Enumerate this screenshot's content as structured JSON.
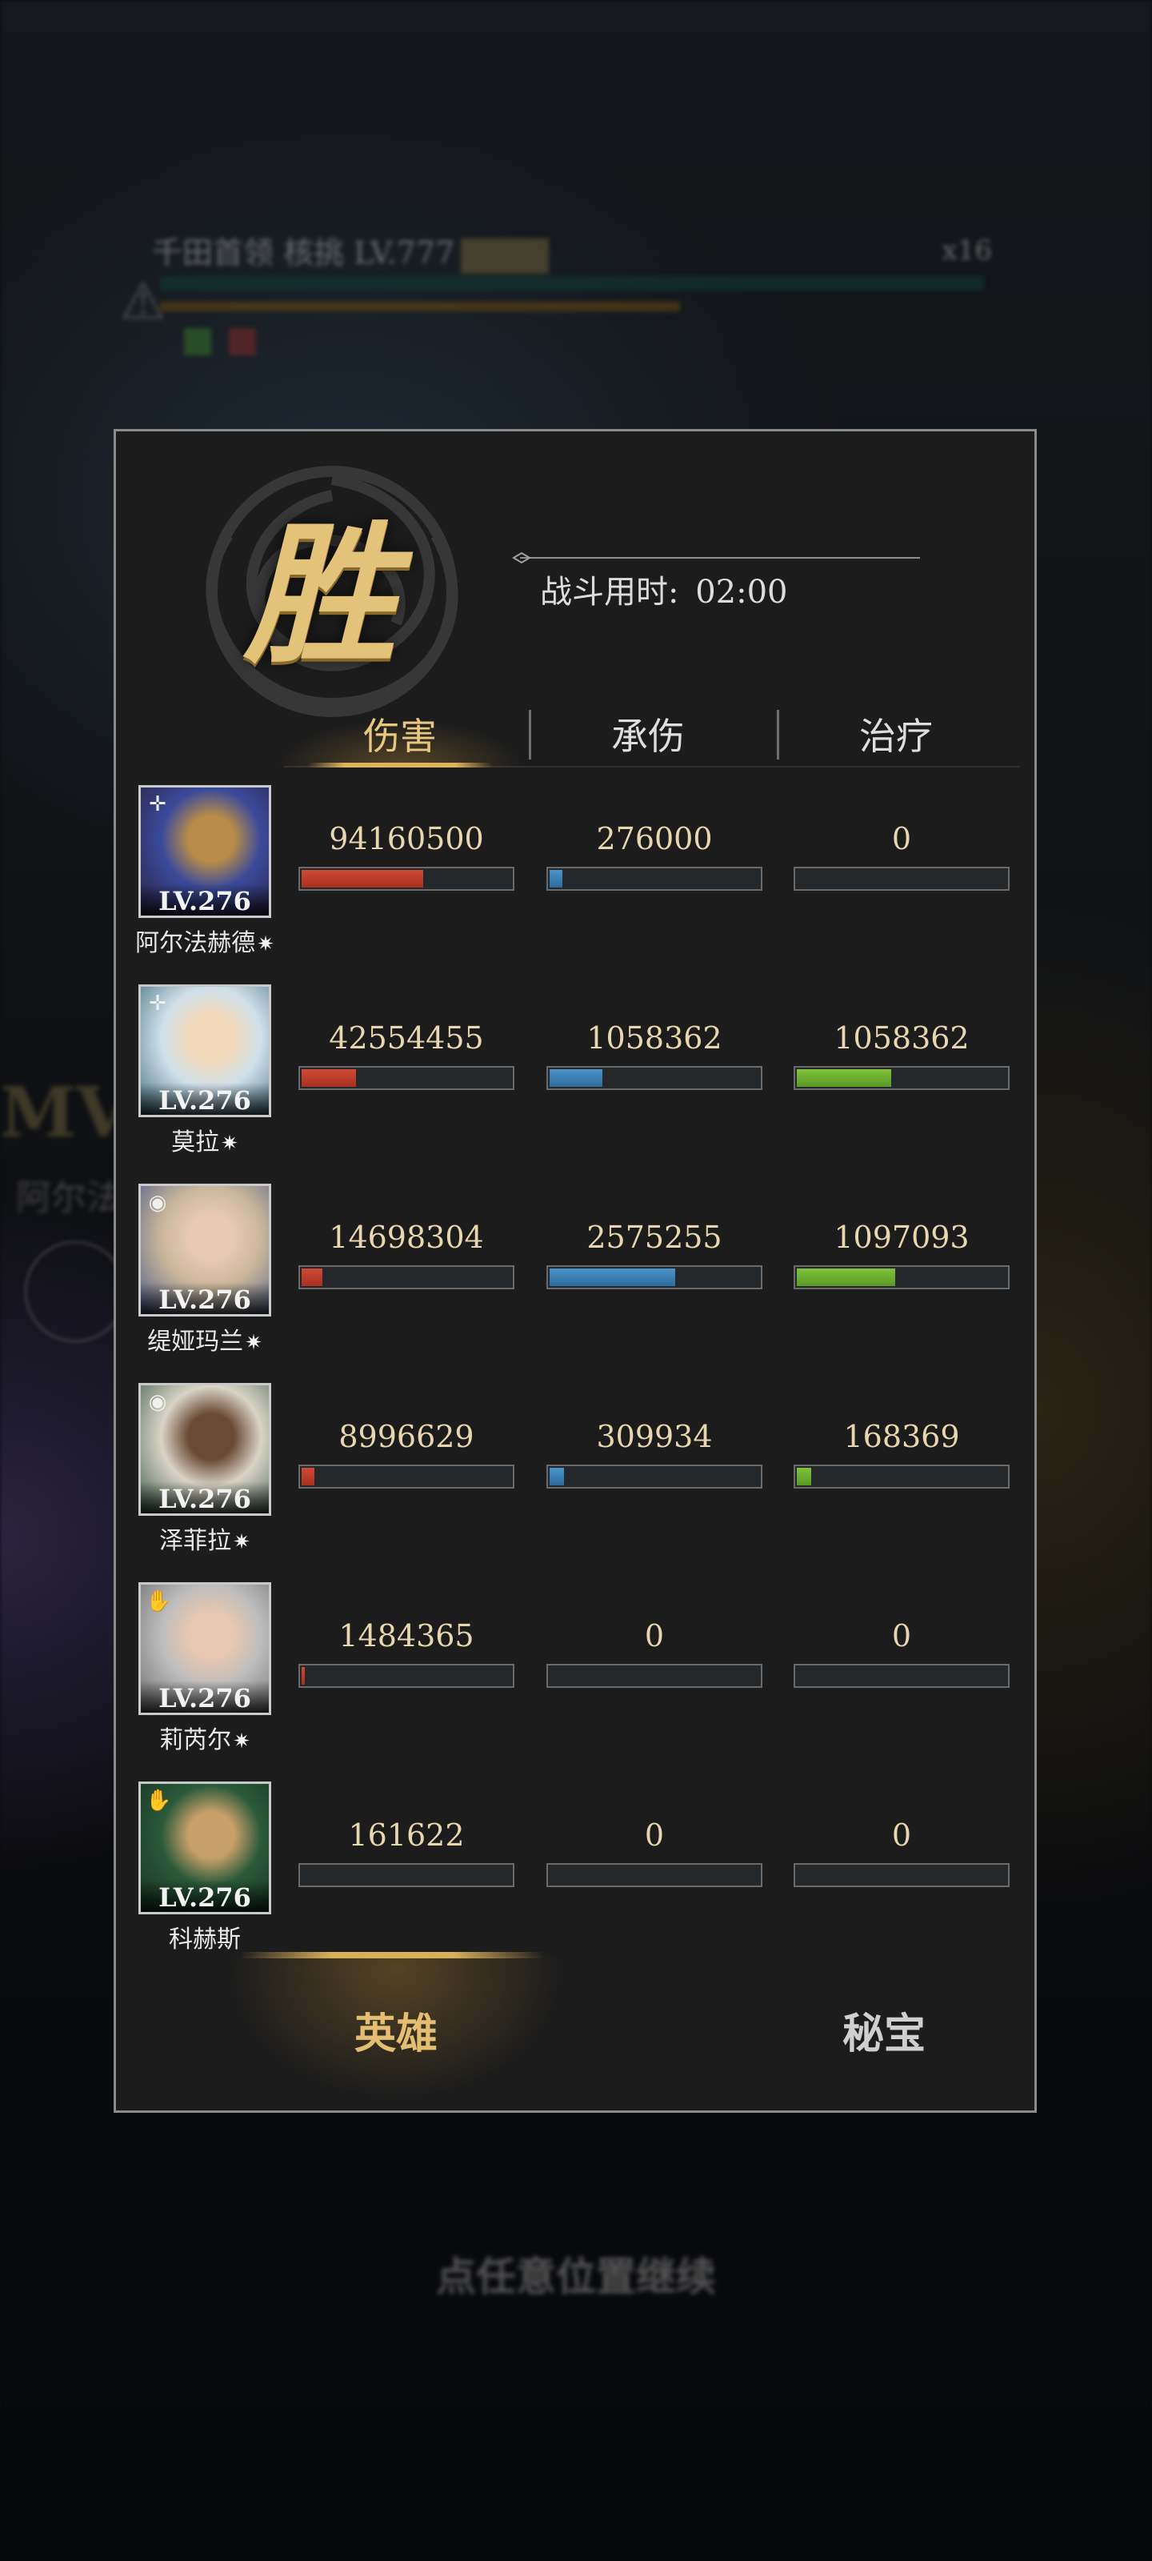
{
  "background": {
    "boss_name": "千田首领 核挑 LV.777",
    "boss_count": "x16",
    "side_mvp": "MV",
    "side_name": "阿尔法",
    "continue_hint": "点任意位置继续"
  },
  "panel": {
    "result_title": "胜",
    "battle_time_label": "战斗用时:",
    "battle_time_value": "02:00",
    "tabs": [
      {
        "label": "伤害",
        "active": true
      },
      {
        "label": "承伤",
        "active": false
      },
      {
        "label": "治疗",
        "active": false
      }
    ],
    "bottom_tabs": [
      {
        "label": "英雄",
        "active": true
      },
      {
        "label": "秘宝",
        "active": false
      }
    ]
  },
  "heroes": [
    {
      "name": "阿尔法赫德",
      "star": "✷",
      "level": "LV.276",
      "class_icon": "cross-icon",
      "class_glyph": "✛",
      "damage": "94160500",
      "damage_pct": 0.58,
      "taken": "276000",
      "taken_pct": 0.06,
      "heal": "0",
      "heal_pct": 0,
      "art": {
        "a": "#3a4a9a",
        "b": "#b98c4a",
        "c": "#2a2040"
      }
    },
    {
      "name": "莫拉",
      "star": "✷",
      "level": "LV.276",
      "class_icon": "cross-icon",
      "class_glyph": "✛",
      "damage": "42554455",
      "damage_pct": 0.26,
      "taken": "1058362",
      "taken_pct": 0.25,
      "heal": "1058362",
      "heal_pct": 0.45,
      "art": {
        "a": "#cfe0ea",
        "b": "#f0d7b8",
        "c": "#3d6a7a"
      }
    },
    {
      "name": "缇娅玛兰",
      "star": "✷",
      "level": "LV.276",
      "class_icon": "swirl-icon",
      "class_glyph": "◉",
      "damage": "14698304",
      "damage_pct": 0.1,
      "taken": "2575255",
      "taken_pct": 0.6,
      "heal": "1097093",
      "heal_pct": 0.47,
      "art": {
        "a": "#c9b79a",
        "b": "#e9c9b4",
        "c": "#4a5a8a"
      }
    },
    {
      "name": "泽菲拉",
      "star": "✷",
      "level": "LV.276",
      "class_icon": "swirl-icon",
      "class_glyph": "◉",
      "damage": "8996629",
      "damage_pct": 0.06,
      "taken": "309934",
      "taken_pct": 0.07,
      "heal": "168369",
      "heal_pct": 0.07,
      "art": {
        "a": "#d9d4c6",
        "b": "#6a4a34",
        "c": "#3a5a4a"
      }
    },
    {
      "name": "莉芮尔",
      "star": "✷",
      "level": "LV.276",
      "class_icon": "hand-icon",
      "class_glyph": "✋",
      "damage": "1484365",
      "damage_pct": 0.01,
      "taken": "0",
      "taken_pct": 0,
      "heal": "0",
      "heal_pct": 0,
      "art": {
        "a": "#bdbdbd",
        "b": "#e8c8b0",
        "c": "#6a6a6a"
      }
    },
    {
      "name": "科赫斯",
      "star": "",
      "level": "LV.276",
      "class_icon": "hand-icon",
      "class_glyph": "✋",
      "damage": "161622",
      "damage_pct": 0,
      "taken": "0",
      "taken_pct": 0,
      "heal": "0",
      "heal_pct": 0,
      "art": {
        "a": "#2a5a3a",
        "b": "#c8a06a",
        "c": "#16301f"
      }
    }
  ]
}
